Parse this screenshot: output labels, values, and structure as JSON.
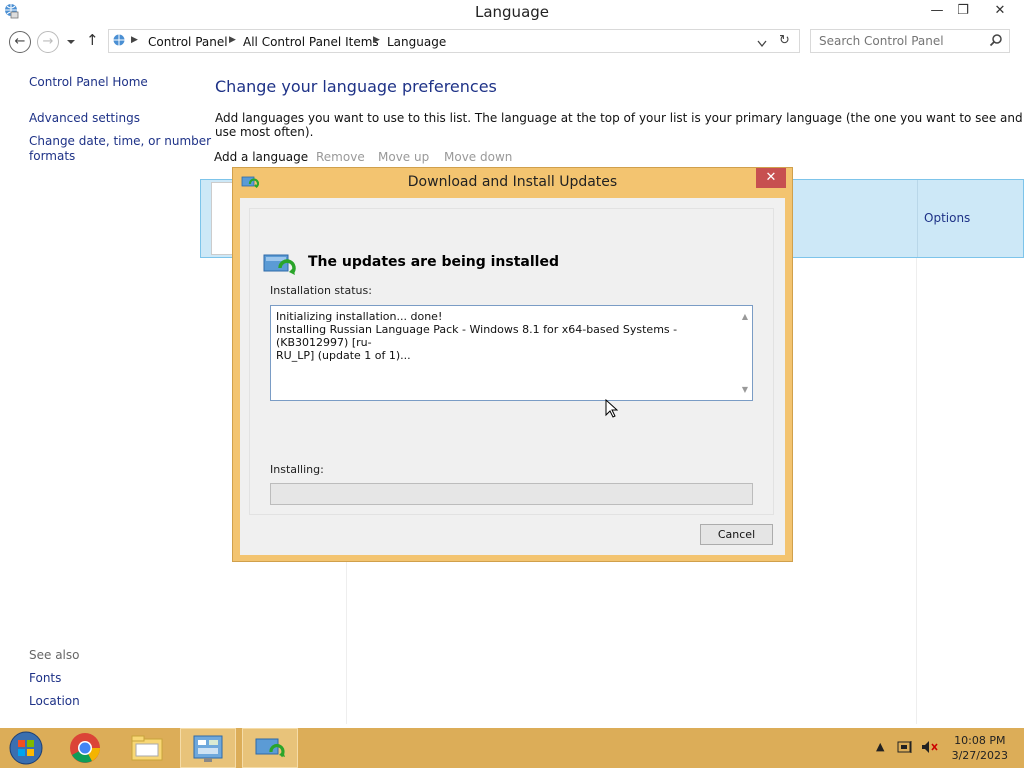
{
  "window": {
    "title": "Language",
    "icon": "globe-control-panel-icon",
    "minimize_glyph": "—",
    "restore_glyph": "❐",
    "close_glyph": "✕"
  },
  "address_bar": {
    "back_glyph": "←",
    "forward_glyph": "→",
    "up_glyph": "↑",
    "breadcrumbs": [
      "Control Panel",
      "All Control Panel Items",
      "Language"
    ],
    "refresh_glyph": "↻"
  },
  "search": {
    "placeholder": "Search Control Panel"
  },
  "left_nav": {
    "home": "Control Panel Home",
    "links": [
      "Advanced settings",
      "Change date, time, or number",
      "formats"
    ],
    "see_also_title": "See also",
    "see_also": [
      "Fonts",
      "Location"
    ]
  },
  "main": {
    "heading": "Change your language preferences",
    "description": "Add languages you want to use to this list. The language at the top of your list is your primary language (the one you want to see and use most often).",
    "toolbar": {
      "add": "Add a language",
      "remove": "Remove",
      "move_up": "Move up",
      "move_down": "Move down"
    },
    "options_link": "Options"
  },
  "dialog": {
    "title": "Download and Install Updates",
    "close_glyph": "✕",
    "heading": "The updates are being installed",
    "status_label": "Installation status:",
    "status_lines": [
      "Initializing installation... done!",
      "Installing Russian Language Pack - Windows 8.1 for x64-based Systems - (KB3012997) [ru-",
      "RU_LP] (update 1 of 1)..."
    ],
    "installing_label": "Installing:",
    "progress_fraction": 0.0,
    "cancel_label": "Cancel"
  },
  "taskbar": {
    "items": [
      "start-orb",
      "chrome",
      "file-explorer",
      "control-panel",
      "windows-update"
    ],
    "time": "10:08 PM",
    "date": "3/27/2023"
  },
  "colors": {
    "link": "#1e3287",
    "dialog_frame": "#f3c470",
    "taskbar": "#dcad58",
    "selection": "#cde8f7"
  }
}
